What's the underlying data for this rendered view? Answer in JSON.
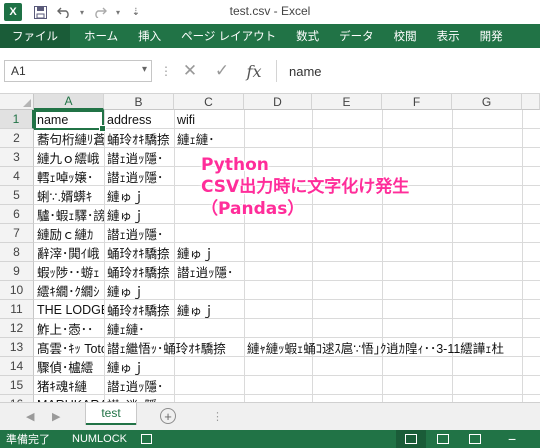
{
  "window": {
    "title": "test.csv - Excel",
    "app_icon": "X"
  },
  "quick_access": [
    {
      "icon": "save-icon",
      "glyph": "💾"
    },
    {
      "icon": "undo-icon",
      "glyph": "↶"
    },
    {
      "icon": "redo-icon",
      "glyph": "↷"
    },
    {
      "icon": "customize-qat-icon",
      "glyph": "⇣"
    }
  ],
  "ribbon_tabs": [
    "ファイル",
    "ホーム",
    "挿入",
    "ページ レイアウト",
    "数式",
    "データ",
    "校閲",
    "表示",
    "開発"
  ],
  "formula_bar": {
    "name_box": "A1",
    "formula": "name"
  },
  "columns": [
    "A",
    "B",
    "C",
    "D",
    "E",
    "F",
    "G"
  ],
  "rows": [
    {
      "num": "1",
      "a": "name",
      "b": "address",
      "c": "wifi",
      "d": ""
    },
    {
      "num": "2",
      "a": "蕎句桁縺ﾘ蒼",
      "b": "蛹玲ｵｷ驕捺",
      "c": "縺ｪ縺･",
      "d": ""
    },
    {
      "num": "3",
      "a": "縺九ｏ繧峨",
      "b": "譛ｪ逍ｯ隱･",
      "c": "",
      "d": ""
    },
    {
      "num": "4",
      "a": "轌ｪ啅ｯ嬢･",
      "b": "譛ｪ逍ｯ隱･",
      "c": "",
      "d": ""
    },
    {
      "num": "5",
      "a": "蜊∵.婿蠎ｷ",
      "b": "縺ゅｊ",
      "c": "",
      "d": ""
    },
    {
      "num": "6",
      "a": "驢･蝦ｪ驛･謗",
      "b": "縺ゅｊ",
      "c": "",
      "d": ""
    },
    {
      "num": "7",
      "a": "縺励ｃ縺ｶ",
      "b": "譛ｪ逍ｯ隱･",
      "c": "",
      "d": ""
    },
    {
      "num": "8",
      "a": "辭滓･閧ｲ峨",
      "b": "蛹玲ｵｷ驕捺",
      "c": "縺ゅｊ",
      "d": ""
    },
    {
      "num": "9",
      "a": "蝦ｯ陟･･蝣ｪ",
      "b": "蛹玲ｵｷ驕捺",
      "c": "譛ｪ逍ｯ隱･",
      "d": ""
    },
    {
      "num": "10",
      "a": "繧ｷ繝･ｸ繝ｼ",
      "b": "縺ゅｊ",
      "c": "",
      "d": ""
    },
    {
      "num": "11",
      "a": "THE LODGE",
      "b": "蛹玲ｵｷ驕捺",
      "c": "縺ゅｊ",
      "d": ""
    },
    {
      "num": "12",
      "a": "鮓上･悫･･",
      "b": "縺ｪ縺･",
      "c": "",
      "d": ""
    },
    {
      "num": "13",
      "a": "髙雲･ｷｯ Totoro",
      "b": "譛ｪ繼悟ｯ･蛹玲ｵｷ驕捺",
      "c": "",
      "d": "縺ｬ縺ｯ蝦ｪ蛹ｺ逑ｽ扈∵悟｣ｸ逍ｶ隍ｨ･･3-11繧譁ｪ杜"
    },
    {
      "num": "14",
      "a": "驟偵･櫨繧",
      "b": "縺ゅｊ",
      "c": "",
      "d": ""
    },
    {
      "num": "15",
      "a": "猪ｷ魂ｷ縺",
      "b": "譛ｪ逍ｯ隱･",
      "c": "",
      "d": ""
    },
    {
      "num": "16",
      "a": "MARUKARA",
      "b": "譛ｪ逍ｯ隱･",
      "c": "",
      "d": ""
    }
  ],
  "overlay": {
    "line1": "Python",
    "line2": "CSV出力時に文字化け発生",
    "line3": "（Pandas）"
  },
  "sheet_tabs": [
    "test"
  ],
  "status": {
    "ready": "準備完了",
    "numlock": "NUMLOCK"
  },
  "colors": {
    "accent": "#217346",
    "overlay_text": "#ff2d9a"
  }
}
